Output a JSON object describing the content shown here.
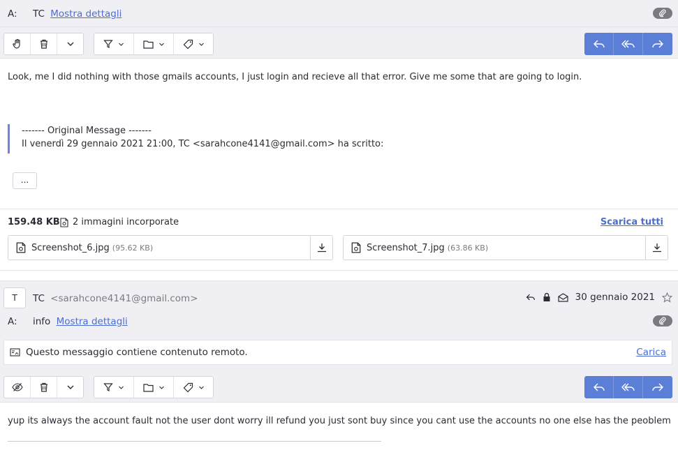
{
  "message1": {
    "to_label": "A:",
    "to_name": "TC",
    "details_link": "Mostra dettagli",
    "body": "Look, me I did nothing with those gmails accounts, I just login and recieve all that error. Give me some that are going to login.",
    "quote_header": "------- Original Message -------",
    "quote_line": "Il venerdì 29 gennaio 2021 21:00, TC <sarahcone4141@gmail.com> ha scritto:",
    "expand_label": "...",
    "attachments": {
      "total_size": "159.48 KB",
      "count_label": "2 immagini incorporate",
      "download_all": "Scarica tutti",
      "files": [
        {
          "name": "Screenshot_6.jpg",
          "size": "(95.62 KB)"
        },
        {
          "name": "Screenshot_7.jpg",
          "size": "(63.86 KB)"
        }
      ]
    }
  },
  "message2": {
    "avatar_initial": "T",
    "sender_name": "TC",
    "sender_email": "<sarahcone4141@gmail.com>",
    "date": "30 gennaio 2021",
    "to_label": "A:",
    "to_name": "info",
    "details_link": "Mostra dettagli",
    "remote_notice": "Questo messaggio contiene contenuto remoto.",
    "remote_load": "Carica",
    "body": "yup its always the account fault not the user dont worry ill refund you just sont buy since you cant use the accounts no one else has the peoblem"
  },
  "colors": {
    "accent": "#5b7fd6",
    "link": "#4a6ed0",
    "header_bg": "#f0f0f4"
  }
}
